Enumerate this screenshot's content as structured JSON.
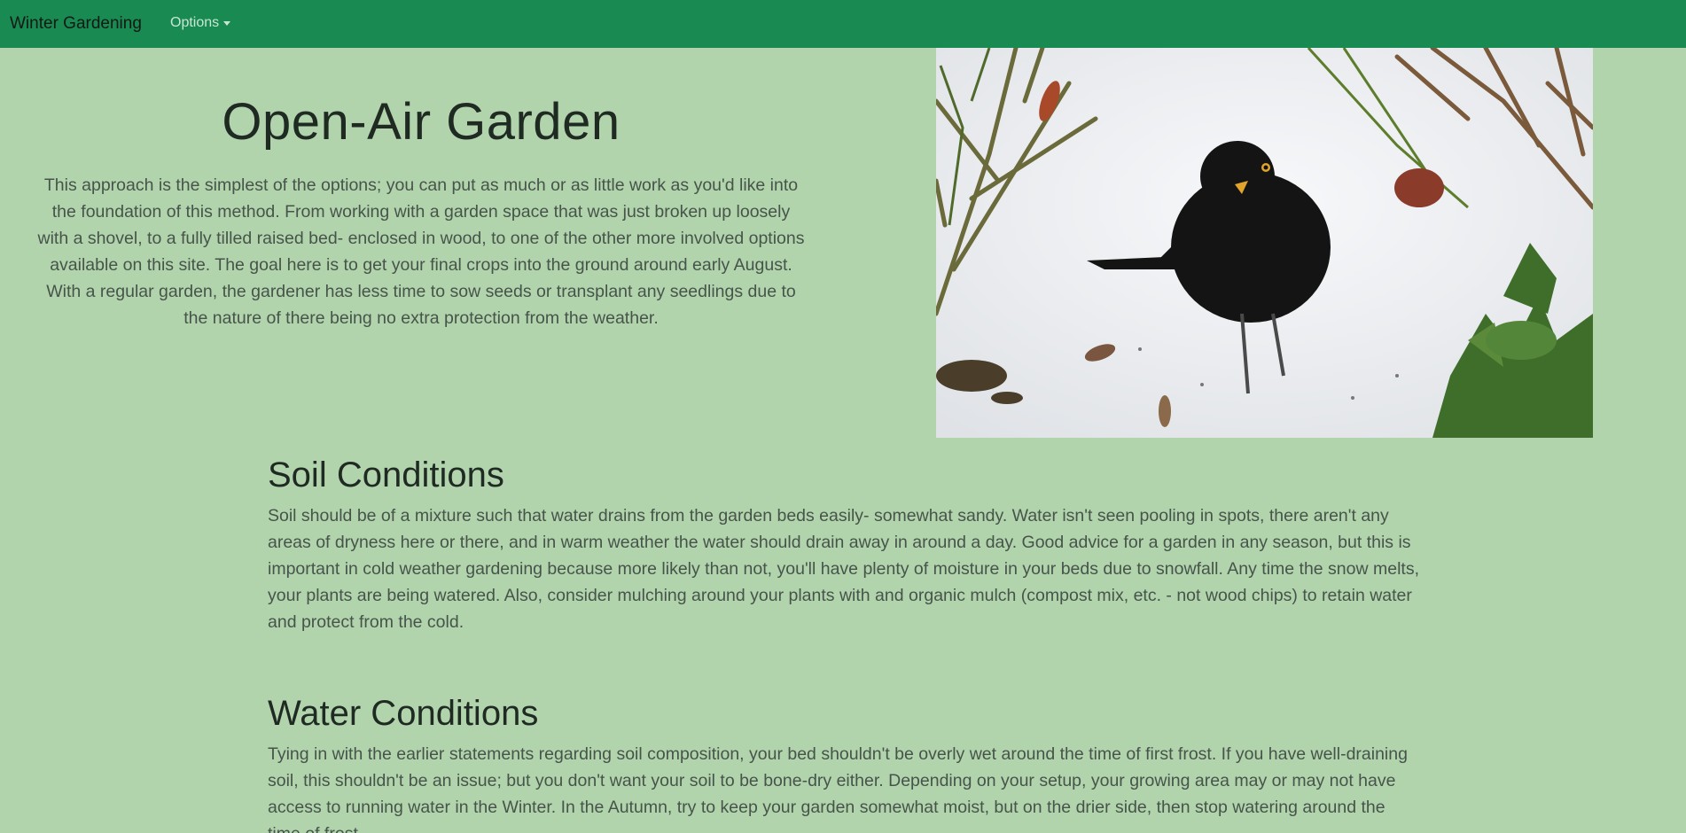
{
  "navbar": {
    "brand": "Winter Gardening",
    "options_label": "Options"
  },
  "hero": {
    "title": "Open-Air Garden",
    "text": "This approach is the simplest of the options; you can put as much or as little work as you'd like into the foundation of this method. From working with a garden space that was just broken up loosely with a shovel, to a fully tilled raised bed- enclosed in wood, to one of the other more involved options available on this site. The goal here is to get your final crops into the ground around early August. With a regular garden, the gardener has less time to sow seeds or transplant any seedlings due to the nature of there being no extra protection from the weather."
  },
  "sections": [
    {
      "title": "Soil Conditions",
      "text": "Soil should be of a mixture such that water drains from the garden beds easily- somewhat sandy. Water isn't seen pooling in spots, there aren't any areas of dryness here or there, and in warm weather the water should drain away in around a day. Good advice for a garden in any season, but this is important in cold weather gardening because more likely than not, you'll have plenty of moisture in your beds due to snowfall. Any time the snow melts, your plants are being watered. Also, consider mulching around your plants with and organic mulch (compost mix, etc. - not wood chips) to retain water and protect from the cold."
    },
    {
      "title": "Water Conditions",
      "text": "Tying in with the earlier statements regarding soil composition, your bed shouldn't be overly wet around the time of first frost. If you have well-draining soil, this shouldn't be an issue; but you don't want your soil to be bone-dry either. Depending on your setup, your growing area may or may not have access to running water in the Winter. In the Autumn, try to keep your garden somewhat moist, but on the drier side, then stop watering around the time of frost."
    }
  ],
  "colors": {
    "navbar": "#198a52",
    "background": "#b2d4ad"
  }
}
